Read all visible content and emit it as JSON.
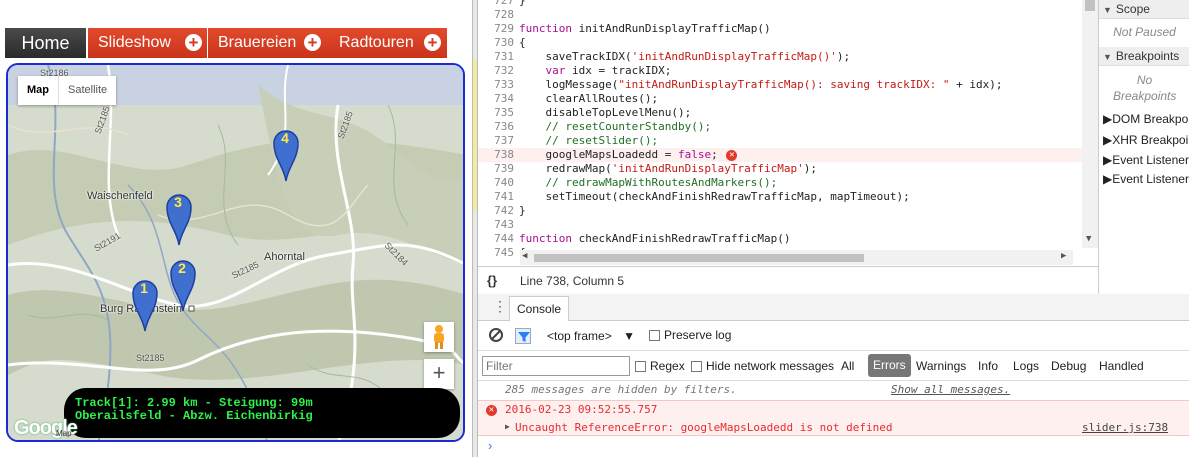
{
  "nav": {
    "home": "Home",
    "items": [
      {
        "label": "Slideshow"
      },
      {
        "label": "Brauereien"
      },
      {
        "label": "Radtouren"
      }
    ],
    "plus": "+"
  },
  "map": {
    "type_map": "Map",
    "type_satellite": "Satellite",
    "places": [
      {
        "name": "Waischenfeld"
      },
      {
        "name": "Ahorntal"
      },
      {
        "name": "Burg Rabenstein"
      }
    ],
    "roads": [
      "St2186",
      "St2191",
      "St2185",
      "St2185",
      "St2185",
      "St2184",
      "St2185"
    ],
    "markers": [
      "1",
      "2",
      "3",
      "4"
    ],
    "zoom_in": "+",
    "info": {
      "line1": "Track[1]: 2.99 km - Steigung: 99m",
      "line2": "Oberailsfeld - Abzw. Eichenbirkig"
    },
    "google": "Google",
    "footer": "Map"
  },
  "devtools": {
    "code_lines": [
      {
        "n": "727",
        "html": "}"
      },
      {
        "n": "728",
        "html": ""
      },
      {
        "n": "729",
        "html": "<span class='kw'>function</span> initAndRunDisplayTrafficMap()"
      },
      {
        "n": "730",
        "html": "{"
      },
      {
        "n": "731",
        "html": "    saveTrackIDX(<span class='str'>'initAndRunDisplayTrafficMap()'</span>);"
      },
      {
        "n": "732",
        "html": "    <span class='kw'>var</span> idx = trackIDX;"
      },
      {
        "n": "733",
        "html": "    logMessage(<span class='str'>\"initAndRunDisplayTrafficMap(): saving trackIDX: \"</span> + idx);"
      },
      {
        "n": "734",
        "html": "    clearAllRoutes();"
      },
      {
        "n": "735",
        "html": "    disableTopLevelMenu();"
      },
      {
        "n": "736",
        "html": "    <span class='cmt'>// resetCounterStandby();</span>"
      },
      {
        "n": "737",
        "html": "    <span class='cmt'>// resetSlider();</span>"
      },
      {
        "n": "738",
        "html": "    googleMapsLoadedd = <span class='kw'>false</span>; <span class='erricon'>✕</span>",
        "error": true
      },
      {
        "n": "739",
        "html": "    redrawMap(<span class='str'>'initAndRunDisplayTrafficMap'</span>);"
      },
      {
        "n": "740",
        "html": "    <span class='cmt'>// redrawMapWithRoutesAndMarkers();</span>"
      },
      {
        "n": "741",
        "html": "    setTimeout(checkAndFinishRedrawTrafficMap, mapTimeout);"
      },
      {
        "n": "742",
        "html": "}"
      },
      {
        "n": "743",
        "html": ""
      },
      {
        "n": "744",
        "html": "<span class='kw'>function</span> checkAndFinishRedrawTrafficMap()"
      },
      {
        "n": "745",
        "html": "{"
      }
    ],
    "status": {
      "braces": "{}",
      "cursor": "Line 738, Column 5"
    },
    "sidebar": {
      "scope": "Scope",
      "not_paused": "Not Paused",
      "breakpoints": "Breakpoints",
      "no_breakpoints": "No Breakpoints",
      "dom": "DOM Breakpoints",
      "xhr": "XHR Breakpoints",
      "event_listener": "Event Listener Breakpoints",
      "event_listeners": "Event Listeners"
    },
    "console": {
      "tab": "Console",
      "frame": "<top frame>",
      "preserve_log": "Preserve log",
      "filter_placeholder": "Filter",
      "regex": "Regex",
      "hide_network": "Hide network messages",
      "levels": [
        "All",
        "Errors",
        "Warnings",
        "Info",
        "Logs",
        "Debug",
        "Handled"
      ],
      "hidden_msg": "285 messages are hidden by filters.",
      "show_all": "Show all messages.",
      "error_time": "2016-02-23 09:52:55.757",
      "error_text": "Uncaught ReferenceError: googleMapsLoadedd is not defined",
      "error_src": "slider.js:738"
    }
  },
  "colors": {
    "nav_red": "#d43a22",
    "map_border": "#1a2bd1",
    "track_text": "#2cf24a",
    "error": "#e62c2c"
  }
}
